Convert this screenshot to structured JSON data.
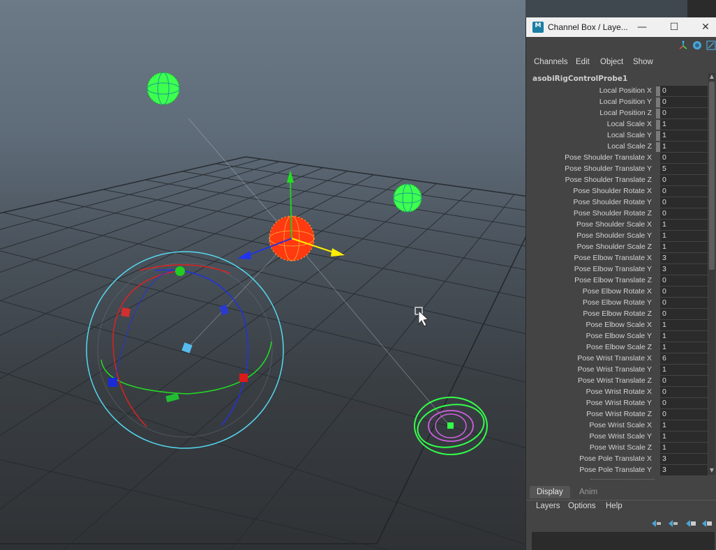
{
  "window": {
    "title": "Channel Box / Laye...",
    "app_icon_label": "M",
    "minimize_glyph": "—",
    "maximize_glyph": "☐",
    "close_glyph": "✕"
  },
  "toolbar": {
    "icons": [
      "manipulator-icon",
      "lock-icon",
      "edit-icon"
    ]
  },
  "menu": {
    "channels": "Channels",
    "edit": "Edit",
    "object": "Object",
    "show": "Show"
  },
  "node_name": "asobiRigControlProbe1",
  "channels": [
    {
      "label": "Local Position X",
      "value": "0",
      "marker": true
    },
    {
      "label": "Local Position Y",
      "value": "0",
      "marker": true
    },
    {
      "label": "Local Position Z",
      "value": "0",
      "marker": true
    },
    {
      "label": "Local Scale X",
      "value": "1",
      "marker": true
    },
    {
      "label": "Local Scale Y",
      "value": "1",
      "marker": true
    },
    {
      "label": "Local Scale Z",
      "value": "1",
      "marker": true
    },
    {
      "label": "Pose Shoulder Translate X",
      "value": "0"
    },
    {
      "label": "Pose Shoulder Translate Y",
      "value": "5"
    },
    {
      "label": "Pose Shoulder Translate Z",
      "value": "0"
    },
    {
      "label": "Pose Shoulder Rotate X",
      "value": "0"
    },
    {
      "label": "Pose Shoulder Rotate Y",
      "value": "0"
    },
    {
      "label": "Pose Shoulder Rotate Z",
      "value": "0"
    },
    {
      "label": "Pose Shoulder Scale X",
      "value": "1"
    },
    {
      "label": "Pose Shoulder Scale Y",
      "value": "1"
    },
    {
      "label": "Pose Shoulder Scale Z",
      "value": "1"
    },
    {
      "label": "Pose Elbow Translate X",
      "value": "3"
    },
    {
      "label": "Pose Elbow Translate Y",
      "value": "3"
    },
    {
      "label": "Pose Elbow Translate Z",
      "value": "0"
    },
    {
      "label": "Pose Elbow Rotate X",
      "value": "0"
    },
    {
      "label": "Pose Elbow Rotate Y",
      "value": "0"
    },
    {
      "label": "Pose Elbow Rotate Z",
      "value": "0"
    },
    {
      "label": "Pose Elbow Scale X",
      "value": "1"
    },
    {
      "label": "Pose Elbow Scale Y",
      "value": "1"
    },
    {
      "label": "Pose Elbow Scale Z",
      "value": "1"
    },
    {
      "label": "Pose Wrist Translate X",
      "value": "6"
    },
    {
      "label": "Pose Wrist Translate Y",
      "value": "1"
    },
    {
      "label": "Pose Wrist Translate Z",
      "value": "0"
    },
    {
      "label": "Pose Wrist Rotate X",
      "value": "0"
    },
    {
      "label": "Pose Wrist Rotate Y",
      "value": "0"
    },
    {
      "label": "Pose Wrist Rotate Z",
      "value": "0"
    },
    {
      "label": "Pose Wrist Scale X",
      "value": "1"
    },
    {
      "label": "Pose Wrist Scale Y",
      "value": "1"
    },
    {
      "label": "Pose Wrist Scale Z",
      "value": "1"
    },
    {
      "label": "Pose Pole Translate X",
      "value": "3"
    },
    {
      "label": "Pose Pole Translate Y",
      "value": "3"
    }
  ],
  "layer_editor": {
    "tabs": [
      {
        "label": "Display",
        "active": true
      },
      {
        "label": "Anim",
        "active": false
      }
    ],
    "menu": {
      "layers": "Layers",
      "options": "Options",
      "help": "Help"
    },
    "icons": [
      "move-layer-up-icon",
      "move-layer-down-icon",
      "new-layer-icon",
      "new-layer-from-selected-icon"
    ]
  },
  "colors": {
    "viewport_top": "#6c7a88",
    "viewport_bottom": "#2f3235",
    "panel_bg": "#444444",
    "field_bg": "#2b2b2b",
    "control_green": "#33ff4a",
    "control_red": "#ff3a10",
    "probe_ring": "#55d8f0",
    "axis_x": "#dd2222",
    "axis_y": "#22bb22",
    "axis_z": "#2233dd",
    "manip_yellow": "#ffee00",
    "pole_magenta": "#d060e0"
  }
}
